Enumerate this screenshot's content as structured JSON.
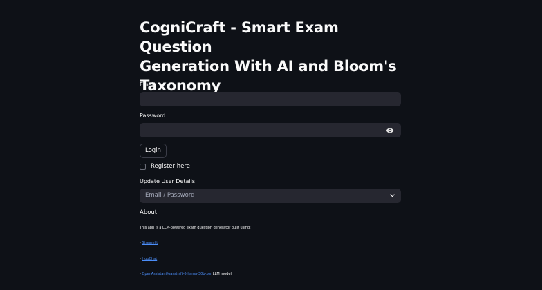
{
  "title": "CogniCraft - Smart Exam Question Generation With AI and Bloom's Taxonomy",
  "title_lines": [
    "CogniCraft - Smart Exam Question",
    "Generation With AI and Bloom's",
    "Taxonomy"
  ],
  "email": {
    "label": "Email",
    "value": ""
  },
  "password": {
    "label": "Password",
    "value": ""
  },
  "login_button": "Login",
  "register_checkbox": {
    "label": "Register here",
    "checked": false
  },
  "update_details": {
    "label": "Update User Details",
    "selected": "Email / Password"
  },
  "about": {
    "heading": "About",
    "description": "This app is a LLM-powered exam question generator built using:",
    "links": [
      {
        "prefix": "- ",
        "text": "Streamlit",
        "suffix": ""
      },
      {
        "prefix": "- ",
        "text": "HugChat",
        "suffix": ""
      },
      {
        "prefix": "- ",
        "text": "OpenAssistant/oasst-sft-6-llama-30b-xor",
        "suffix": " LLM model"
      }
    ]
  },
  "colors": {
    "background": "#0e1117",
    "input": "#262730",
    "link": "#4b8df8"
  }
}
